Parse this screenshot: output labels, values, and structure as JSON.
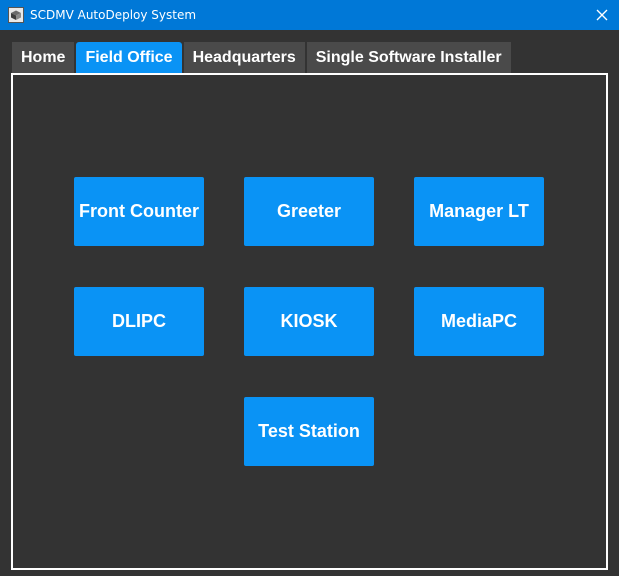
{
  "window": {
    "title": "SCDMV AutoDeploy System",
    "app_icon": "installer-box-icon",
    "close_icon": "close-icon"
  },
  "tabs": [
    {
      "label": "Home",
      "selected": false
    },
    {
      "label": "Field Office",
      "selected": true
    },
    {
      "label": "Headquarters",
      "selected": false
    },
    {
      "label": "Single Software Installer",
      "selected": false
    }
  ],
  "tiles": {
    "front_counter": "Front Counter",
    "greeter": "Greeter",
    "manager_lt": "Manager LT",
    "dlipc": "DLIPC",
    "kiosk": "KIOSK",
    "mediapc": "MediaPC",
    "test_station": "Test Station"
  },
  "colors": {
    "titlebar": "#0078d7",
    "accent": "#0a93f5",
    "background": "#333333",
    "tab_inactive": "#4a4a4a",
    "panel_border": "#ffffff"
  }
}
